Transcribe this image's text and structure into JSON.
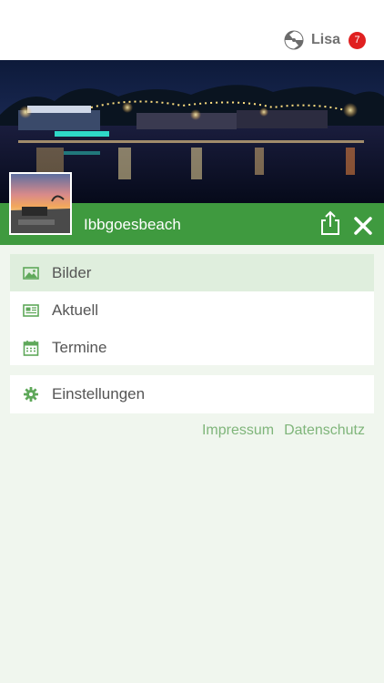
{
  "header": {
    "user_name": "Lisa",
    "notification_count": "7",
    "logo_icon": "pinwheel-logo-icon"
  },
  "banner": {
    "image": "night-lake-lights-photo"
  },
  "group": {
    "title": "Ibbgoesbeach",
    "thumbnail": "sunset-beach-thumbnail",
    "share_icon": "share-icon",
    "close_icon": "close-icon"
  },
  "menu": {
    "items": [
      {
        "label": "Bilder",
        "icon": "image-icon",
        "active": true
      },
      {
        "label": "Aktuell",
        "icon": "newspaper-icon",
        "active": false
      },
      {
        "label": "Termine",
        "icon": "calendar-icon",
        "active": false
      }
    ],
    "settings": {
      "label": "Einstellungen",
      "icon": "gear-icon"
    }
  },
  "footer": {
    "impressum": "Impressum",
    "datenschutz": "Datenschutz"
  },
  "colors": {
    "accent": "#3f9a3f",
    "badge": "#e02020",
    "background": "#f0f6ee",
    "link": "#7fb57a"
  }
}
